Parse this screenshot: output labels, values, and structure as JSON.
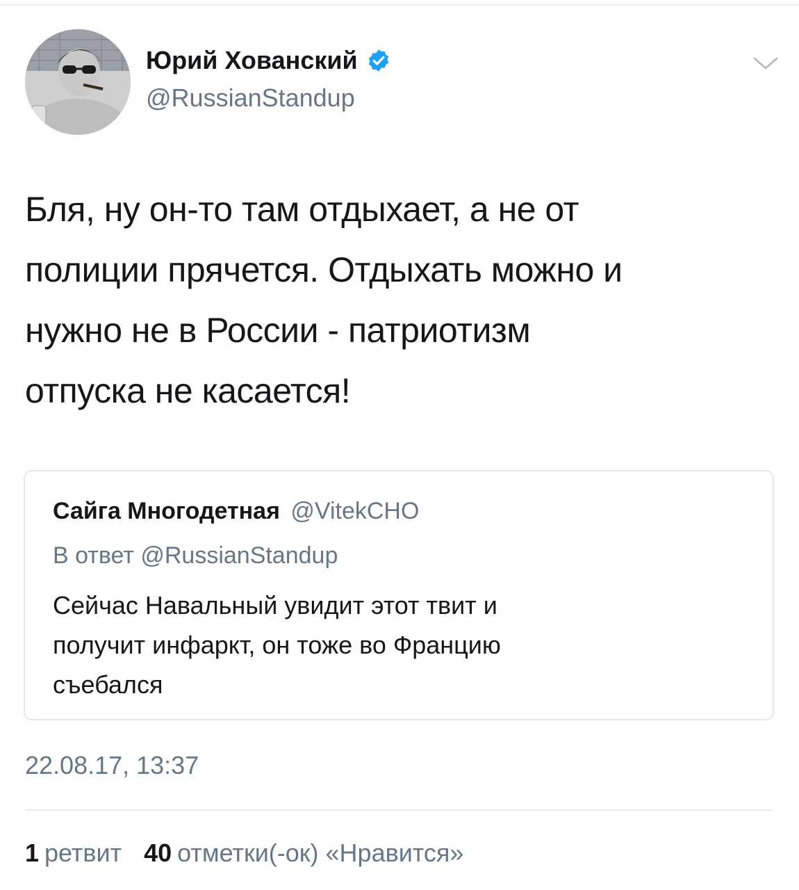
{
  "author": {
    "display_name": "Юрий Хованский",
    "handle": "@RussianStandup",
    "verified": true,
    "avatar_icon": "profile-photo"
  },
  "tweet": {
    "lines": [
      "Бля, ну он-то там отдыхает, а не от",
      "полиции прячется. Отдыхать можно и",
      "нужно не в России - патриотизм",
      "отпуска не касается!"
    ],
    "timestamp": "22.08.17, 13:37"
  },
  "quoted": {
    "display_name": "Сайга Многодетная",
    "handle": "@VitekCHO",
    "reply_to": "В ответ @RussianStandup",
    "lines": [
      "Сейчас Навальный увидит этот твит и",
      "получит инфаркт, он тоже во Францию",
      "съебался"
    ]
  },
  "stats": {
    "retweets_count": "1",
    "retweets_label": "ретвит",
    "likes_count": "40",
    "likes_label": "отметки(-ок) «Нравится»"
  },
  "colors": {
    "text": "#14171a",
    "secondary": "#657786",
    "verified": "#1da1f2",
    "border": "#e1e8ed"
  }
}
